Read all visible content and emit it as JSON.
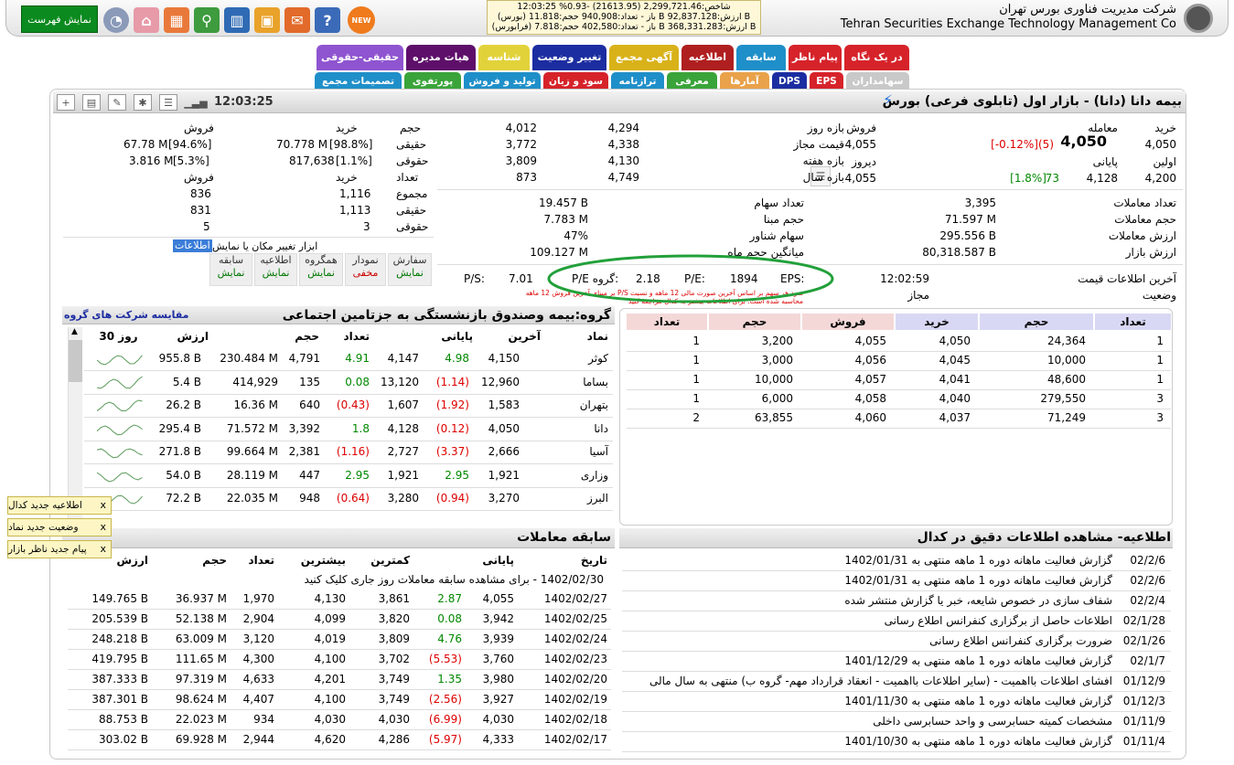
{
  "topbar": {
    "menu_button": "نمایش فهرست",
    "new_badge": "NEW",
    "index_lines": [
      "شاخص:2,299,721.46 (21613.95) -0.93%   12:03:25",
      "(بورس) باز - تعداد:940,908 حجم:11.818 B ارزش:92,837.128 B",
      "(فرابورس) باز - تعداد:402,580 حجم:7.818 B ارزش:368,331.283 B"
    ],
    "company_fa": "شرکت مدیریت فناوری بورس تهران",
    "company_en": "Tehran Securities Exchange Technology Management Co"
  },
  "tabs_row1": [
    "در یک نگاه",
    "پیام ناظر",
    "سابقه",
    "اطلاعیه",
    "آگهی مجمع",
    "تغییر وضعیت",
    "شناسه",
    "هیات مدیره",
    "حقیقی-حقوقی"
  ],
  "tabs_row2": [
    "سهامداران",
    "EPS",
    "DPS",
    "آمارها",
    "معرفی",
    "ترازنامه",
    "سود و زیان",
    "تولید و فروش",
    "پورتفوی",
    "تصمیمات مجمع"
  ],
  "header": {
    "title": "بیمه دانا (دانا) - بازار اول (تابلوی فرعی) بورس",
    "clock": "12:03:25"
  },
  "quote": {
    "buy_label": "خرید",
    "buy": "4,050",
    "trade_label": "معامله",
    "last": "4,050",
    "last_change": "(5)",
    "last_pct": "[-0.12%]",
    "sell_label": "فروش",
    "sell": "4,055",
    "first_label": "اولین",
    "first": "4,200",
    "close_label": "پایانی",
    "close": "4,128",
    "close_change": "73",
    "close_pct": "[1.8%]",
    "yesterday_label": "دیروز",
    "yesterday": "4,055"
  },
  "ranges": {
    "day_label": "بازه روز",
    "day_lo": "4,294",
    "day_hi": "4,012",
    "allowed_label": "قیمت مجاز",
    "allowed_lo": "4,338",
    "allowed_hi": "3,772",
    "week_label": "بازه هفته",
    "week_lo": "4,130",
    "week_hi": "3,809",
    "year_label": "بازه سال",
    "year_lo": "4,749",
    "year_hi": "873"
  },
  "stats": {
    "count_label": "تعداد معاملات",
    "count": "3,395",
    "vol_label": "حجم معاملات",
    "vol": "71.597 M",
    "value_label": "ارزش معاملات",
    "value": "295.556 B",
    "mcap_label": "ارزش بازار",
    "mcap": "80,318.587 B",
    "shares_label": "تعداد سهام",
    "shares": "19.457 B",
    "base_label": "حجم مبنا",
    "base": "7.783 M",
    "float_label": "سهام شناور",
    "float": "47%",
    "avgvol_label": "میانگین حجم ماه",
    "avgvol": "109.127 M",
    "lastinfo_label": "آخرین اطلاعات قیمت",
    "lastinfo": "12:02:59",
    "status_label": "وضعیت",
    "status": "مجاز",
    "eps_label": "EPS:",
    "eps": "1894",
    "pe_label": "P/E:",
    "pe": "2.18",
    "gpe_label": "P/E گروه:",
    "gpe": "7.01",
    "ps_label": "P/S:",
    "ps": "",
    "note1": "سود هر سهم بر اساس آخرین صورت مالی 12 ماهه و نسبت P/S بر مبنای آخرین فروش 12 ماهه",
    "note2": "محاسبه شده است. برای اطلاعات بیشتر به کدال مراجعه کنید",
    "ttm": "(TTM)"
  },
  "legal": {
    "vol_label": "حجم",
    "buy_label": "خرید",
    "sell_label": "فروش",
    "ind_label": "حقیقی",
    "corp_label": "حقوقی",
    "count_label": "تعداد",
    "sum_label": "مجموع",
    "vol_ind_buy": "70.778 M",
    "vol_ind_buy_pct": "[98.8%]",
    "vol_ind_sell": "67.78 M",
    "vol_ind_sell_pct": "[94.6%]",
    "vol_corp_buy": "817,638",
    "vol_corp_buy_pct": "[1.1%]",
    "vol_corp_sell": "3.816 M",
    "vol_corp_sell_pct": "[5.3%]",
    "cnt_sum_buy": "1,116",
    "cnt_sum_sell": "836",
    "cnt_ind_buy": "1,113",
    "cnt_ind_sell": "831",
    "cnt_corp_buy": "3",
    "cnt_corp_sell": "5"
  },
  "tools": {
    "caption": "ابزار تغییر مکان یا نمایش",
    "info_link": "اطلاعات",
    "items": [
      {
        "t": "سفارش",
        "a": "نمایش"
      },
      {
        "t": "نمودار",
        "a": "مخفی"
      },
      {
        "t": "همگروه",
        "a": "نمایش"
      },
      {
        "t": "اطلاعیه",
        "a": "نمایش"
      },
      {
        "t": "سابقه",
        "a": "نمایش"
      }
    ]
  },
  "orderbook": {
    "headers": [
      "تعداد",
      "حجم",
      "خرید",
      "فروش",
      "حجم",
      "تعداد"
    ],
    "rows": [
      [
        "1",
        "24,364",
        "4,050",
        "4,055",
        "3,200",
        "1"
      ],
      [
        "1",
        "10,000",
        "4,045",
        "4,056",
        "3,000",
        "1"
      ],
      [
        "1",
        "48,600",
        "4,041",
        "4,057",
        "10,000",
        "1"
      ],
      [
        "3",
        "279,550",
        "4,040",
        "4,058",
        "6,000",
        "1"
      ],
      [
        "3",
        "71,249",
        "4,037",
        "4,060",
        "63,855",
        "2"
      ]
    ]
  },
  "group": {
    "title": "گروه:بیمه وصندوق بازنشستگی به جزتامین اجتماعی",
    "compare_link": "مقایسه شرکت های گروه",
    "headers": [
      "نماد",
      "آخرین",
      "پایانی",
      "تعداد",
      "حجم",
      "ارزش",
      "30 روز"
    ],
    "rows": [
      [
        "کوثر",
        "4,150",
        "4.98",
        "4,147",
        "4.91",
        "4,791",
        "230.484 M",
        "955.8 B"
      ],
      [
        "بساما",
        "12,960",
        "(1.14)",
        "13,120",
        "0.08",
        "135",
        "414,929",
        "5.4 B"
      ],
      [
        "بتهران",
        "1,583",
        "(1.92)",
        "1,607",
        "(0.43)",
        "640",
        "16.36 M",
        "26.2 B"
      ],
      [
        "دانا",
        "4,050",
        "(0.12)",
        "4,128",
        "1.8",
        "3,392",
        "71.572 M",
        "295.4 B"
      ],
      [
        "آسیا",
        "2,666",
        "(3.37)",
        "2,727",
        "(1.16)",
        "2,381",
        "99.664 M",
        "271.8 B"
      ],
      [
        "وزاری",
        "1,921",
        "2.95",
        "1,921",
        "2.95",
        "447",
        "28.119 M",
        "54.0 B"
      ],
      [
        "البرز",
        "3,270",
        "(0.94)",
        "3,280",
        "(0.64)",
        "948",
        "22.035 M",
        "72.2 B"
      ]
    ]
  },
  "history": {
    "title": "سابقه معاملات",
    "headers": [
      "تاریخ",
      "پایانی",
      "کمترین",
      "بیشترین",
      "تعداد",
      "حجم",
      "ارزش"
    ],
    "today_note": "1402/02/30 - برای مشاهده سابقه معاملات روز جاری کلیک کنید",
    "rows": [
      [
        "1402/02/27",
        "4,055",
        "2.87",
        "3,861",
        "4,130",
        "1,970",
        "36.937 M",
        "149.765 B"
      ],
      [
        "1402/02/25",
        "3,942",
        "0.08",
        "3,820",
        "4,099",
        "2,904",
        "52.138 M",
        "205.539 B"
      ],
      [
        "1402/02/24",
        "3,939",
        "4.76",
        "3,809",
        "4,019",
        "3,120",
        "63.009 M",
        "248.218 B"
      ],
      [
        "1402/02/23",
        "3,760",
        "(5.53)",
        "3,702",
        "4,100",
        "4,300",
        "111.65 M",
        "419.795 B"
      ],
      [
        "1402/02/20",
        "3,980",
        "1.35",
        "3,749",
        "4,201",
        "4,633",
        "97.319 M",
        "387.333 B"
      ],
      [
        "1402/02/19",
        "3,927",
        "(2.56)",
        "3,749",
        "4,100",
        "4,407",
        "98.624 M",
        "387.301 B"
      ],
      [
        "1402/02/18",
        "4,030",
        "(6.99)",
        "4,030",
        "4,030",
        "934",
        "22.023 M",
        "88.753 B"
      ],
      [
        "1402/02/17",
        "4,333",
        "(5.97)",
        "4,286",
        "4,620",
        "2,944",
        "69.928 M",
        "303.02 B"
      ]
    ]
  },
  "codal": {
    "title": "اطلاعیه- مشاهده اطلاعات دقیق در کدال",
    "rows": [
      [
        "02/2/6",
        "گزارش فعالیت ماهانه دوره 1 ماهه منتهی به 1402/01/31"
      ],
      [
        "02/2/6",
        "گزارش فعالیت ماهانه دوره 1 ماهه منتهی به 1402/01/31"
      ],
      [
        "02/2/4",
        "شفاف سازی در خصوص شایعه، خبر یا گزارش منتشر شده"
      ],
      [
        "02/1/28",
        "اطلاعات حاصل از برگزاری کنفرانس اطلاع رسانی"
      ],
      [
        "02/1/26",
        "ضرورت برگزاری کنفرانس اطلاع رسانی"
      ],
      [
        "02/1/7",
        "گزارش فعالیت ماهانه دوره 1 ماهه منتهی به 1401/12/29"
      ],
      [
        "01/12/9",
        "افشای اطلاعات بااهمیت - (سایر اطلاعات بااهمیت - انعقاد قرارداد مهم- گروه ب) منتهی به سال مالی"
      ],
      [
        "01/12/3",
        "گزارش فعالیت ماهانه دوره 1 ماهه منتهی به 1401/11/30"
      ],
      [
        "01/11/9",
        "مشخصات کمیته حسابرسی و واحد حسابرسی داخلی"
      ],
      [
        "01/11/4",
        "گزارش فعالیت ماهانه دوره 1 ماهه منتهی به 1401/10/30"
      ]
    ]
  },
  "toasts": [
    "اطلاعیه جدید کدال",
    "وضعیت جدید نماد",
    "پیام جدید ناظر بازار"
  ],
  "colors": {
    "green": "#0b8a1f",
    "red": "#dd0000",
    "buy_hdr": "#d8d8f4",
    "sell_hdr": "#f4d8d8"
  }
}
